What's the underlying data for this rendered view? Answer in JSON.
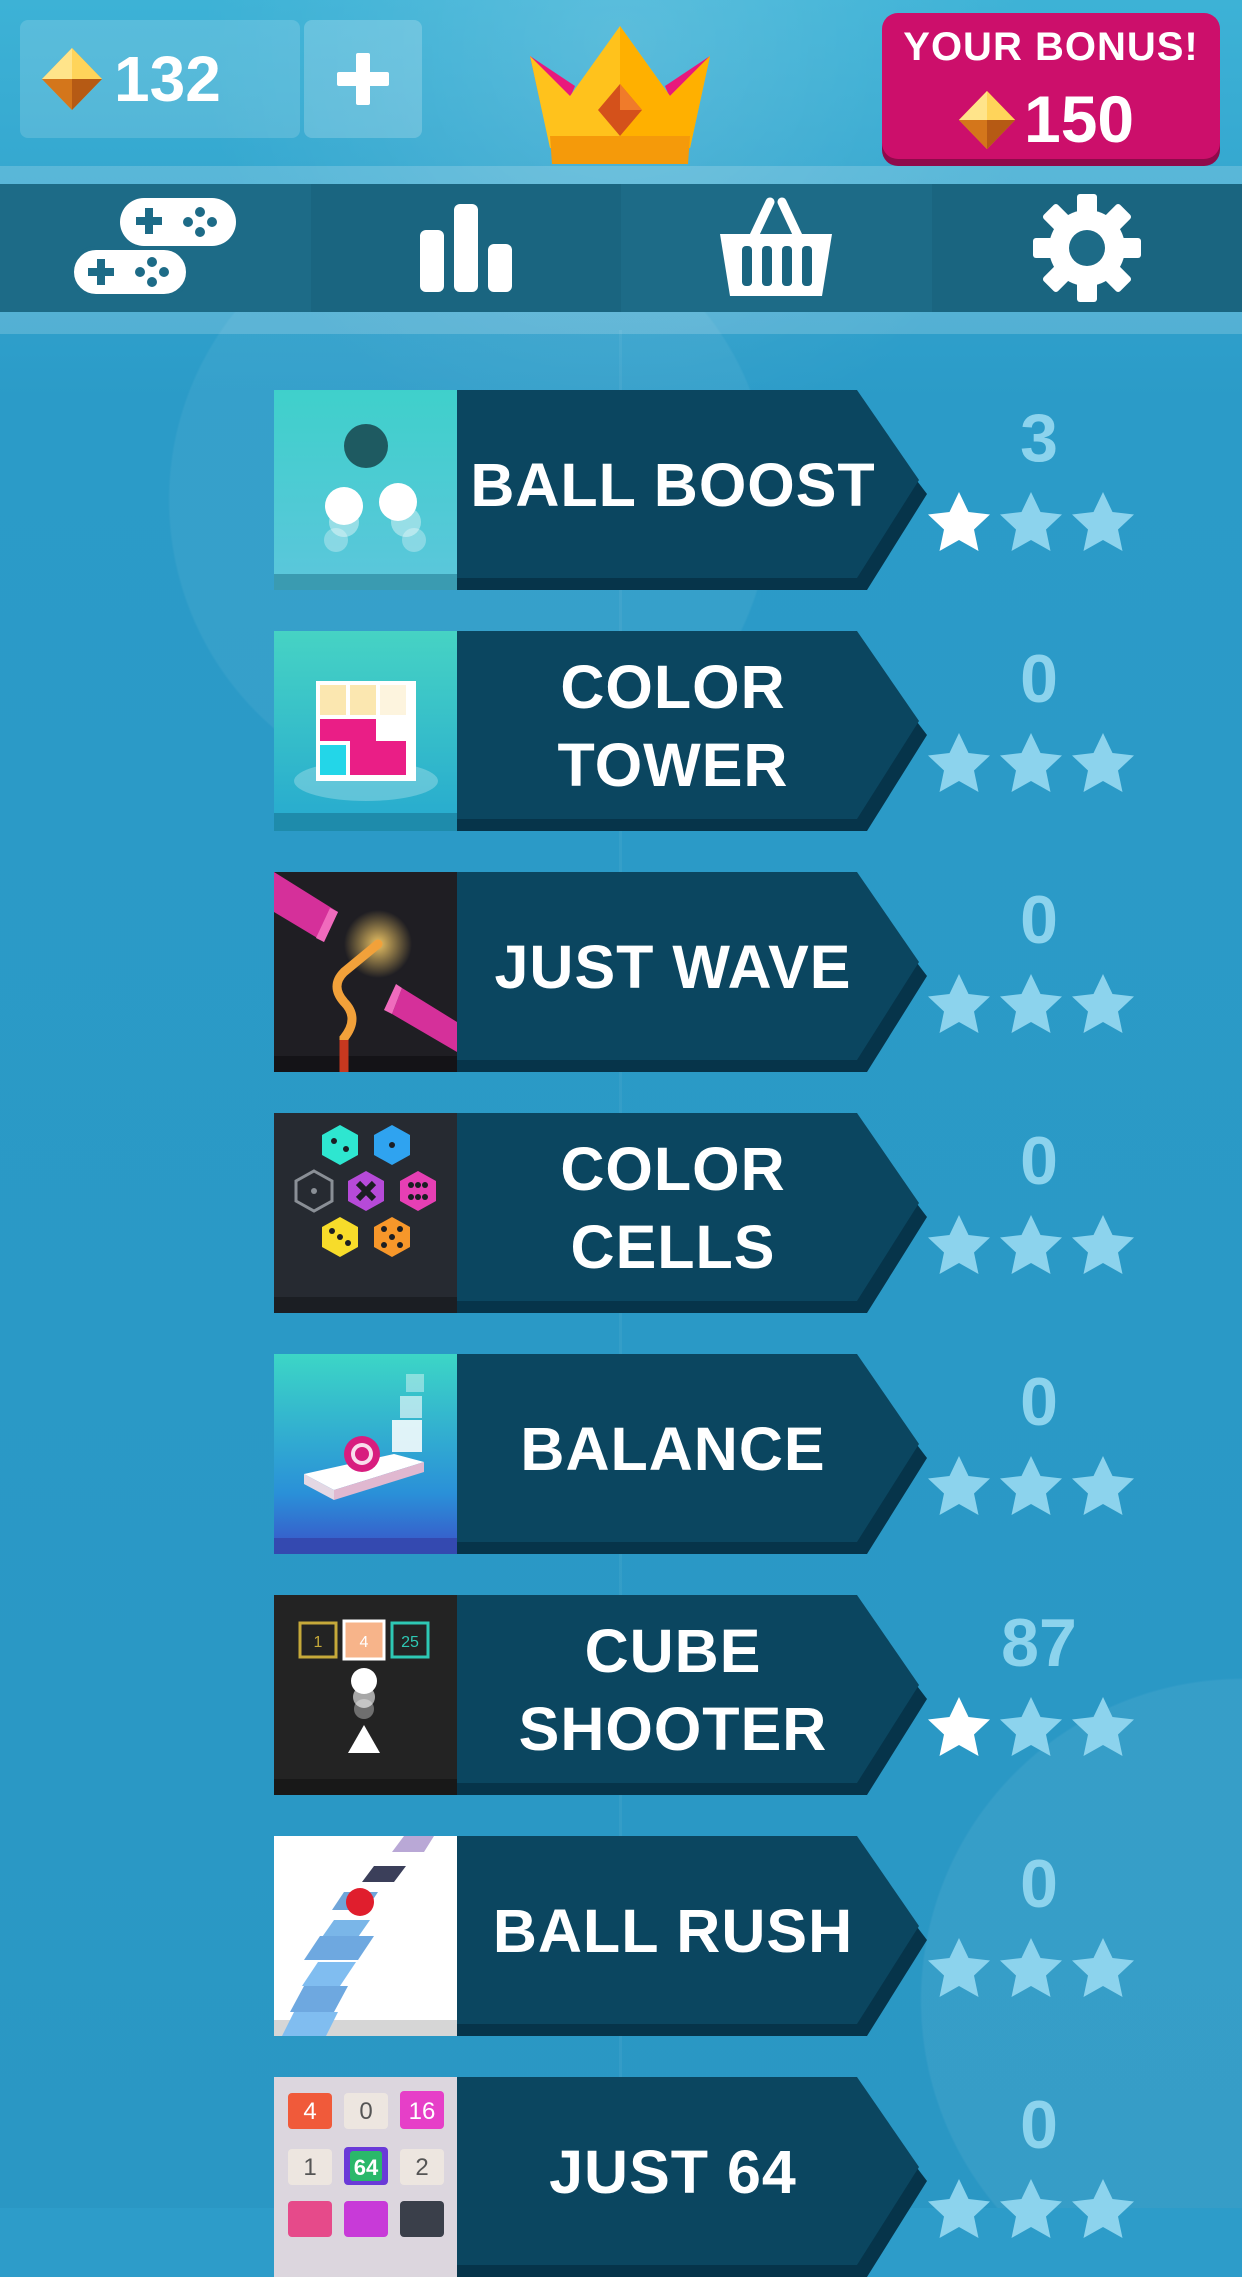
{
  "header": {
    "gem_count": "132",
    "add_gems_icon": "plus-icon",
    "crown_icon": "crown-icon",
    "bonus": {
      "title": "YOUR BONUS!",
      "amount": "150"
    }
  },
  "nav": [
    {
      "icon": "gamepad-icon",
      "name": "games"
    },
    {
      "icon": "leaderboard-icon",
      "name": "stats"
    },
    {
      "icon": "shop-basket-icon",
      "name": "shop"
    },
    {
      "icon": "gear-icon",
      "name": "settings"
    }
  ],
  "games": [
    {
      "title": "BALL BOOST",
      "score": "3",
      "stars": 1
    },
    {
      "title": "COLOR\nTOWER",
      "score": "0",
      "stars": 0
    },
    {
      "title": "JUST WAVE",
      "score": "0",
      "stars": 0
    },
    {
      "title": "COLOR CELLS",
      "score": "0",
      "stars": 0
    },
    {
      "title": "BALANCE",
      "score": "0",
      "stars": 0
    },
    {
      "title": "CUBE\nSHOOTER",
      "score": "87",
      "stars": 1
    },
    {
      "title": "BALL RUSH",
      "score": "0",
      "stars": 0
    },
    {
      "title": "JUST 64",
      "score": "0",
      "stars": 0
    }
  ],
  "thumb_labels": {
    "cube_shooter": [
      "1",
      "4",
      "25"
    ],
    "just64": [
      "4",
      "0",
      "16",
      "1",
      "64",
      "2"
    ]
  },
  "colors": {
    "background": "#2d9cc9",
    "banner": "#0b4660",
    "bonus": "#cc0f6b",
    "score": "#8cd3ed",
    "star_active": "#ffffff",
    "star_inactive": "#8cd3ed"
  }
}
